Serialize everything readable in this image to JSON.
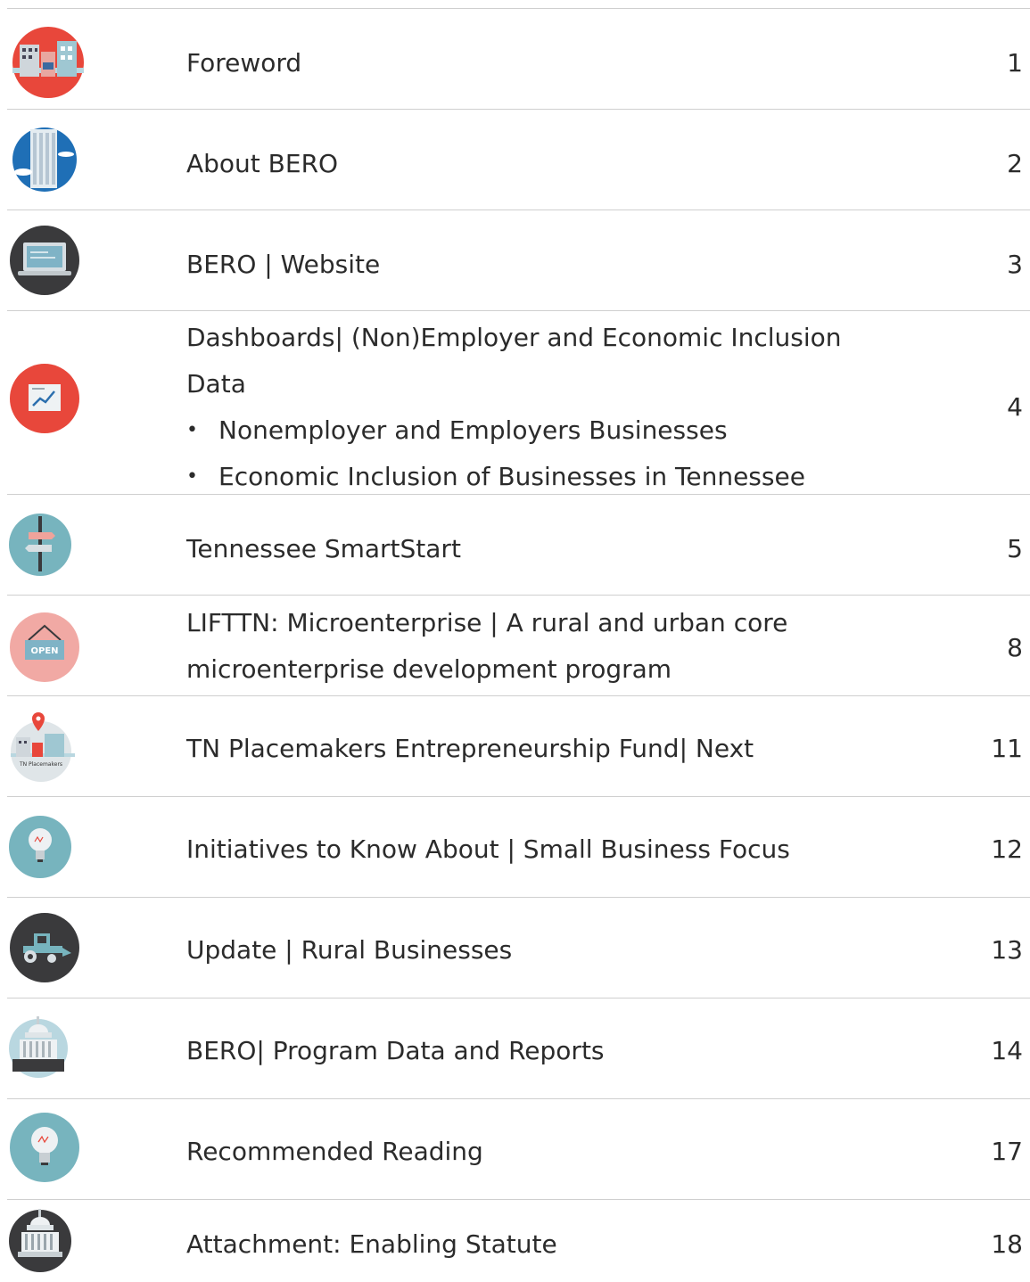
{
  "toc": [
    {
      "title": "Foreword",
      "page": "1",
      "icon": "city-buildings-icon"
    },
    {
      "title": "About BERO",
      "page": "2",
      "icon": "skyscraper-icon"
    },
    {
      "title": "BERO | Website",
      "page": "3",
      "icon": "laptop-icon"
    },
    {
      "title": "Dashboards| (Non)Employer and Economic Inclusion Data",
      "page": "4",
      "icon": "chart-trend-icon",
      "bullets": [
        "Nonemployer  and Employers Businesses",
        "Economic Inclusion of Businesses in Tennessee"
      ]
    },
    {
      "title": "Tennessee SmartStart",
      "page": "5",
      "icon": "signpost-icon"
    },
    {
      "title": "LIFTTN: Microenterprise  | A rural and urban core microenterprise development program",
      "page": "8",
      "icon": "open-sign-icon",
      "icon_text": "OPEN"
    },
    {
      "title": "TN Placemakers Entrepreneurship Fund| Next",
      "page": "11",
      "icon": "placemakers-map-pin-icon",
      "icon_text": "TN Placemakers"
    },
    {
      "title": "Initiatives to Know About | Small Business Focus",
      "page": "12",
      "icon": "lightbulb-icon"
    },
    {
      "title": "Update | Rural Businesses",
      "page": "13",
      "icon": "tractor-icon"
    },
    {
      "title": "BERO| Program Data and Reports",
      "page": "14",
      "icon": "capitol-building-icon"
    },
    {
      "title": "Recommended Reading",
      "page": "17",
      "icon": "lightbulb-icon"
    },
    {
      "title": "Attachment: Enabling Statute",
      "page": "18",
      "icon": "capitol-building-icon"
    }
  ],
  "colors": {
    "red": "#e8473b",
    "blue": "#1f6fb6",
    "dark": "#3a3a3c",
    "teal": "#77b4be",
    "pink": "#f1a9a4",
    "rule": "#cfcfcf"
  }
}
